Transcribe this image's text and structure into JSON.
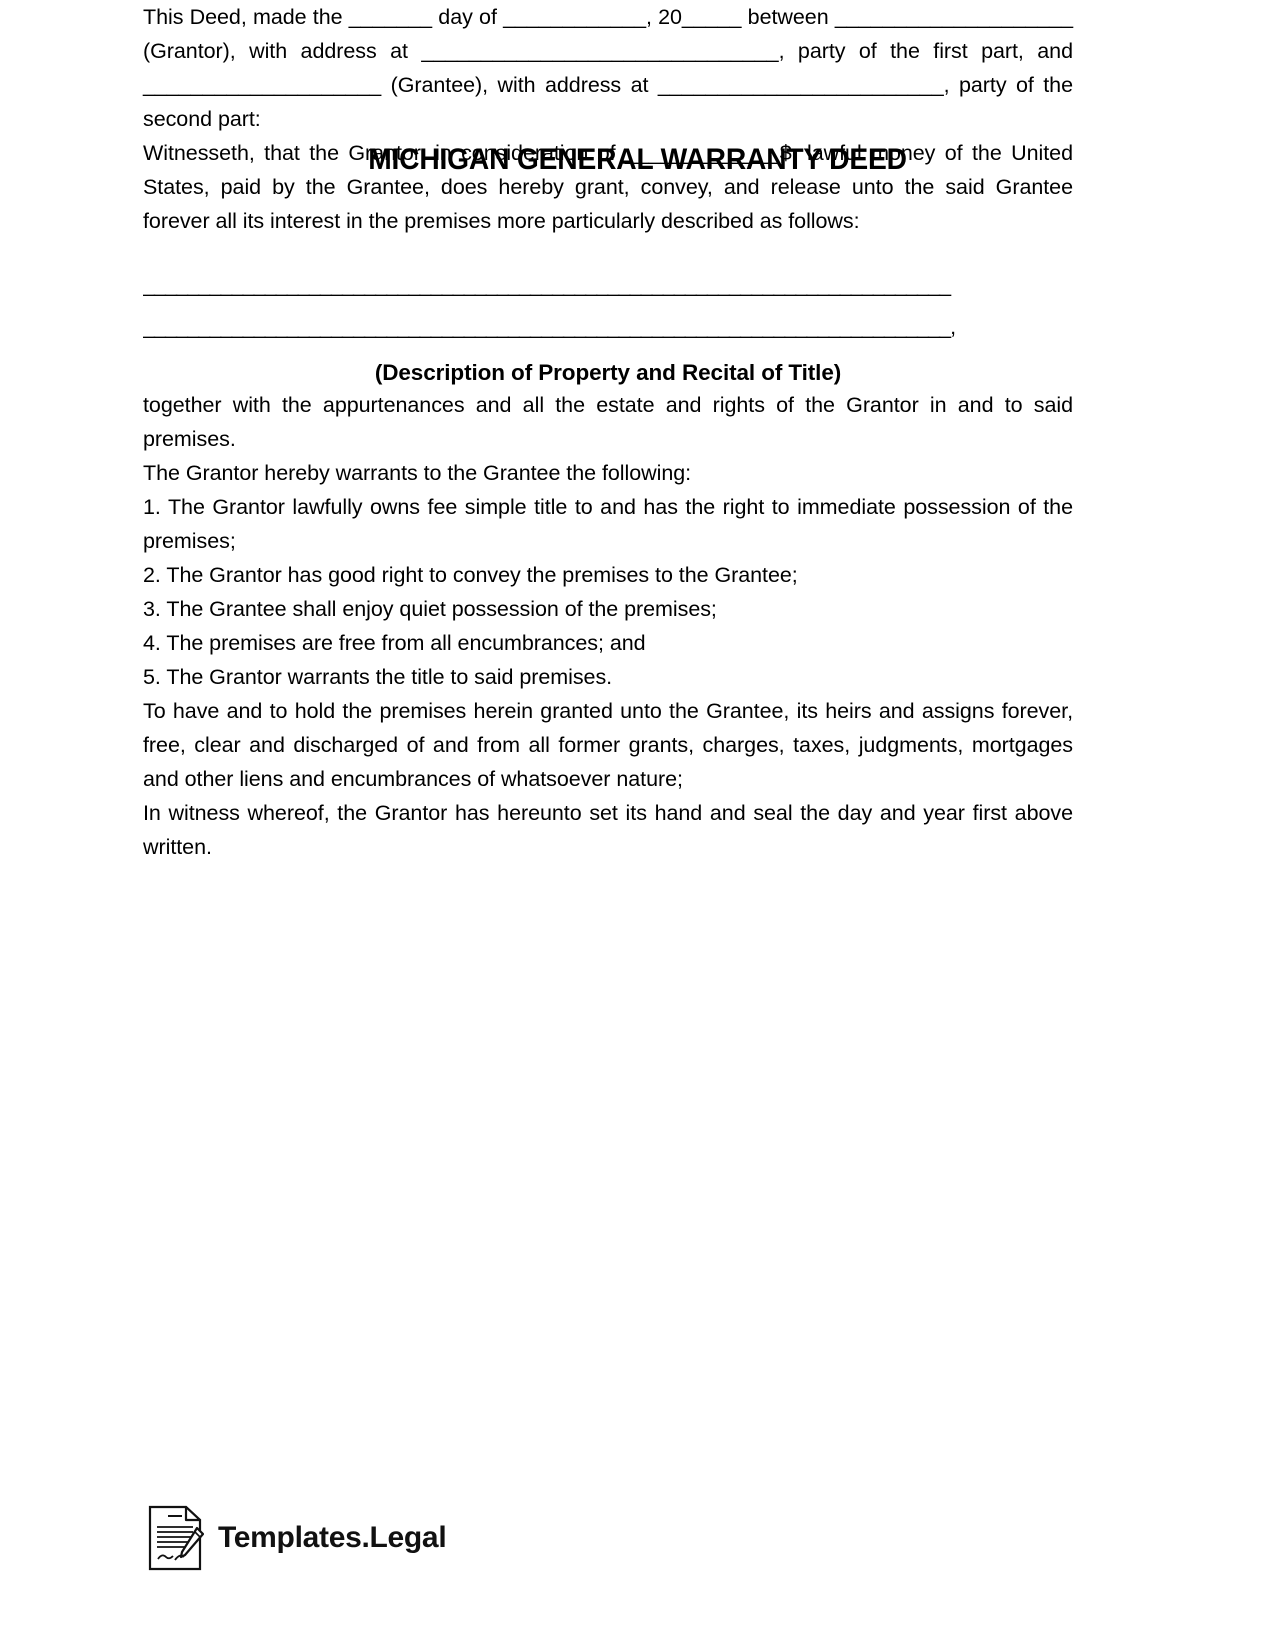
{
  "document": {
    "title": "MICHIGAN GENERAL WARRANTY DEED",
    "paragraphs": {
      "intro": "This Deed, made the _______ day of ____________, 20_____ between ____________________ (Grantor), with address at ______________________________, party of the first part, and ____________________ (Grantee), with address at ________________________, party of the second part:",
      "witnesseth": "Witnesseth, that the Grantor, in consideration of _____________$, lawful money of the United States, paid by the Grantee, does hereby grant, convey, and release unto the said Grantee forever all its interest in the premises more particularly described as follows:",
      "blank_line_1": "_________________________________________________________________________",
      "blank_line_2": "_________________________________________________________________________,",
      "description_heading": "(Description of Property and Recital of Title)",
      "appurtenances": "together with the appurtenances and all the estate and rights of the Grantor in and to said premises.",
      "warrants_intro": "The Grantor hereby warrants to the Grantee the following:",
      "to_have_and_to_hold": "To have and to hold the premises herein granted unto the Grantee, its heirs and assigns forever, free, clear and discharged of and from all former grants, charges, taxes, judgments, mortgages and other liens and encumbrances of whatsoever nature;",
      "in_witness_whereof": "In witness whereof, the Grantor has hereunto set its hand and seal the day and year first above written."
    },
    "warranty_items": [
      "1. The Grantor lawfully owns fee simple title to and has the right to immediate possession of the premises;",
      "2. The Grantor has good right to convey the premises to the Grantee;",
      "3. The Grantee shall enjoy quiet possession of the premises;",
      "4. The premises are free from all encumbrances; and",
      "5. The Grantor warrants the title to said premises."
    ]
  },
  "footer": {
    "brand": "Templates.Legal",
    "logo_icon": "document-with-pen-icon"
  },
  "colors": {
    "text": "#000000",
    "page_background": "#ffffff",
    "brand_text": "#111111"
  }
}
